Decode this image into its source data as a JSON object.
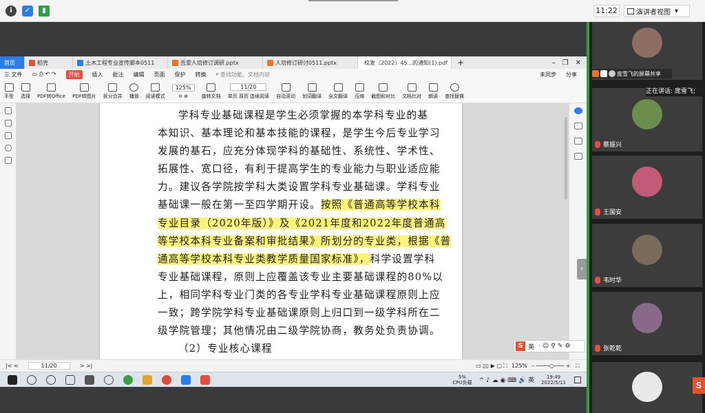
{
  "meeting": {
    "time": "11:22",
    "presenter_view": "演讲者视图",
    "speaking": "正在讲话: 庞雪飞;",
    "share_label": "庞雪飞的屏幕共享",
    "participants": [
      {
        "name": "蔡振兴"
      },
      {
        "name": "王国安"
      },
      {
        "name": "韦时华"
      },
      {
        "name": "张乾乾"
      }
    ]
  },
  "wps": {
    "tabs": [
      {
        "label": "首页"
      },
      {
        "label": "稻壳"
      },
      {
        "label": "土木工程专业宣传脚本0511"
      },
      {
        "label": "吾爱人培修订调研.pptx"
      },
      {
        "label": "人培修订研讨0511.pptx"
      },
      {
        "label": "校发〔2022〕45...的通知(1).pdf"
      }
    ],
    "menu": [
      "三 文件",
      "开始",
      "插入",
      "批注",
      "编辑",
      "页面",
      "保护",
      "转换"
    ],
    "search_placeholder": "查找功能、文档内容",
    "cloud": "未同步",
    "share": "分享",
    "tools": [
      "手型",
      "选择",
      "PDF转Office",
      "PDF转图片",
      "拆分合并",
      "播放",
      "阅读模式",
      "旋转文档",
      "单页",
      "双页",
      "连续阅读",
      "自动滚动",
      "划词翻译",
      "全文翻译",
      "压缩",
      "截图和对比",
      "文档比对",
      "朗读",
      "查找替换"
    ],
    "zoom": "125%",
    "page_num": "11/20",
    "status": {
      "page": "11/20",
      "zoom": "125%"
    }
  },
  "doc": {
    "lines": [
      {
        "pre": "学科专业基础课程是学生必须掌握的本学科专业的基",
        "hl": "",
        "post": "",
        "indent": true
      },
      {
        "pre": "本知识、基本理论和基本技能的课程，是学生今后专业学习",
        "hl": "",
        "post": ""
      },
      {
        "pre": "发展的基石，应充分体现学科的基础性、系统性、学术性、",
        "hl": "",
        "post": ""
      },
      {
        "pre": "拓展性、宽口径，有利于提高学生的专业能力与职业适应能",
        "hl": "",
        "post": ""
      },
      {
        "pre": "力。建议各学院按学科大类设置学科专业基础课。学科专业",
        "hl": "",
        "post": ""
      },
      {
        "pre": "基础课一般在第一至四学期开设。",
        "hl": "按照《普通高等学校本科",
        "post": ""
      },
      {
        "pre": "",
        "hl": "专业目录（2020年版）》及《2021年度和2022年度普通高",
        "post": ""
      },
      {
        "pre": "",
        "hl": "等学校本科专业备案和审批结果》所划分的专业类，根据《普",
        "post": ""
      },
      {
        "pre": "",
        "hl": "通高等学校本科专业类教学质量国家标准》，",
        "post": "科学设置学科"
      },
      {
        "pre": "专业基础课程，原则上应覆盖该专业主要基础课程的80%以",
        "hl": "",
        "post": ""
      },
      {
        "pre": "上，相同学科专业门类的各专业学科专业基础课程原则上应",
        "hl": "",
        "post": ""
      },
      {
        "pre": "一致；跨学院学科专业基础课原则上归口到一级学科所在二",
        "hl": "",
        "post": ""
      },
      {
        "pre": "级学院管理；其他情况由二级学院协商，教务处负责协调。",
        "hl": "",
        "post": ""
      },
      {
        "pre": "（2）专业核心课程",
        "hl": "",
        "post": "",
        "indent": true
      }
    ]
  },
  "taskbar": {
    "cpu": "5%",
    "cpu_label": "CPU负载",
    "time": "19:49",
    "date": "2022/5/11"
  },
  "ime": {
    "lang": "英"
  }
}
